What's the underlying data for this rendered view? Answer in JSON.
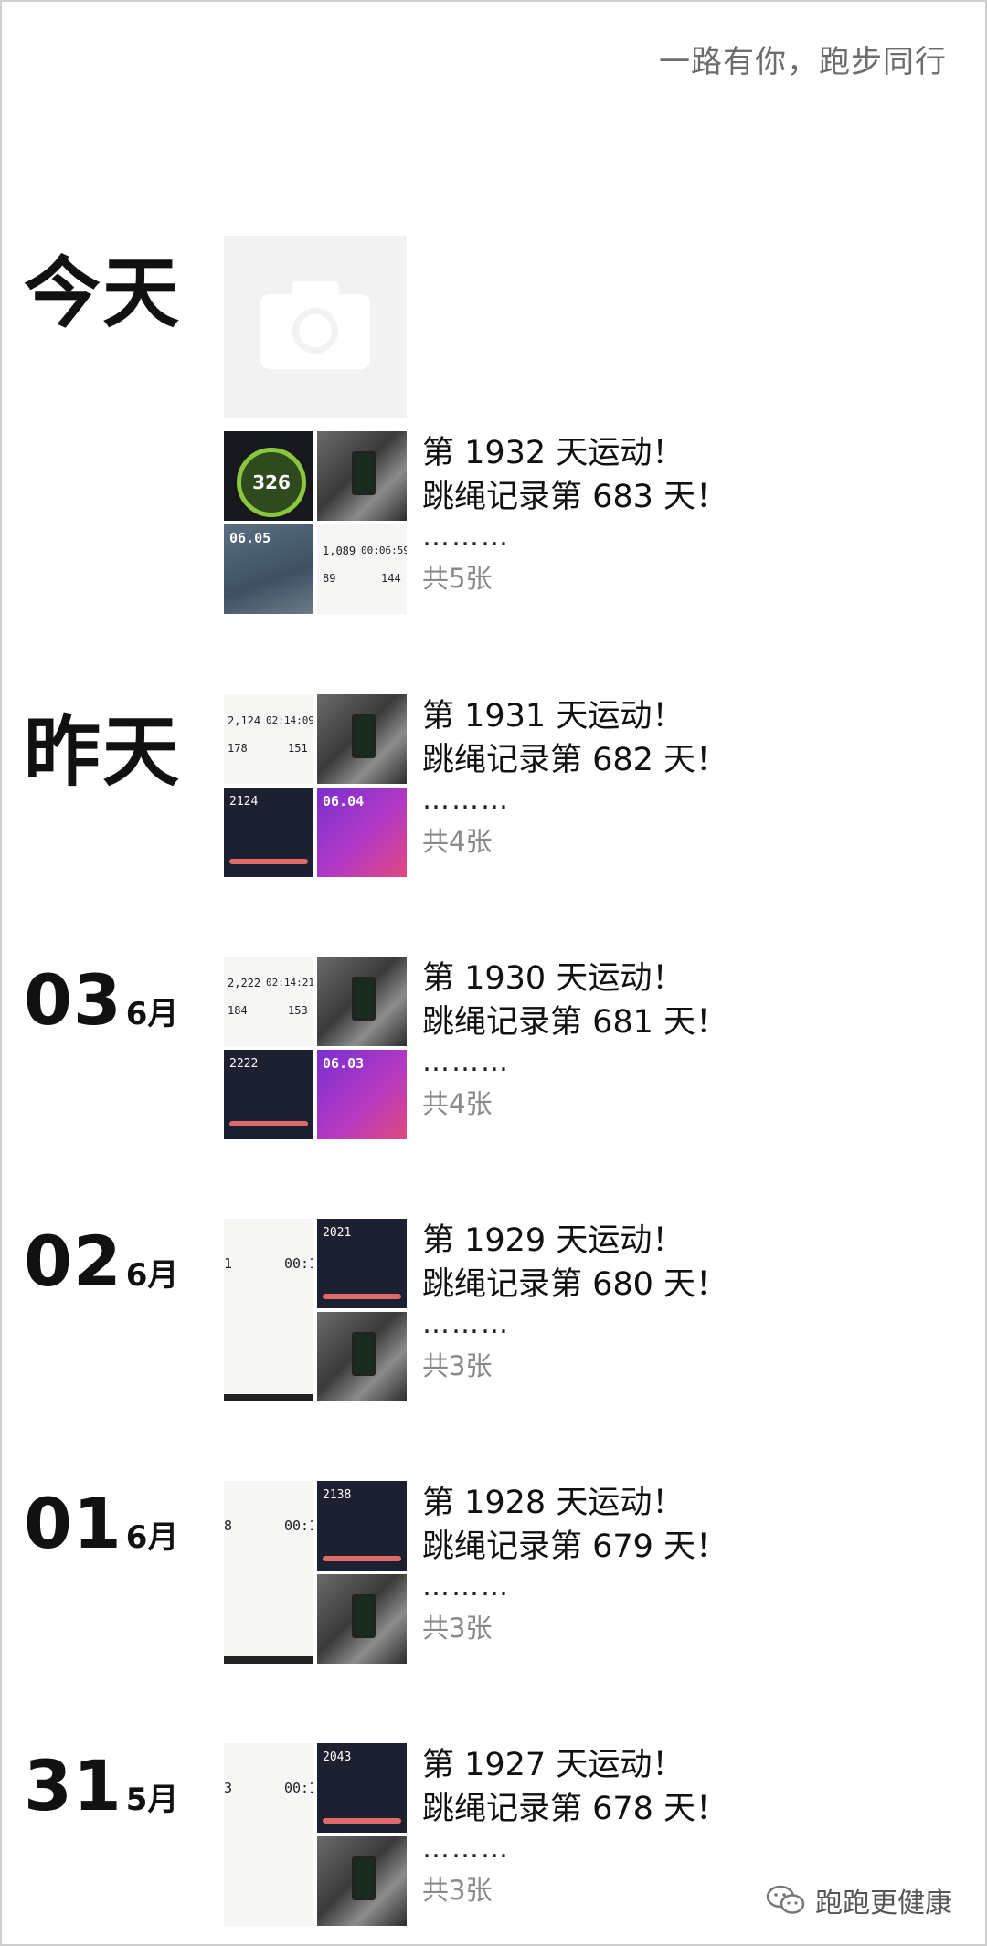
{
  "signature": "一路有你，跑步同行",
  "camera": {
    "icon": "camera-icon"
  },
  "entries": [
    {
      "date_label": "今天",
      "day": "",
      "month": "",
      "line1": "第 1932 天运动！",
      "line2": "跳绳记录第 683 天！",
      "dots": "………",
      "count": "共5张",
      "thumb_text": {
        "badge": "326",
        "date": "06.05",
        "a": "1,089",
        "b": "00:06:59",
        "c": "89",
        "d": "144"
      }
    },
    {
      "date_label": "昨天",
      "day": "",
      "month": "",
      "line1": "第 1931 天运动！",
      "line2": "跳绳记录第 682 天！",
      "dots": "………",
      "count": "共4张",
      "thumb_text": {
        "a": "2,124",
        "b": "02:14:09",
        "c": "178",
        "d": "151",
        "e": "2124",
        "date": "06.04"
      }
    },
    {
      "date_label": "",
      "day": "03",
      "month": "6月",
      "line1": "第 1930 天运动！",
      "line2": "跳绳记录第 681 天！",
      "dots": "………",
      "count": "共4张",
      "thumb_text": {
        "a": "2,222",
        "b": "02:14:21",
        "c": "184",
        "d": "153",
        "e": "2222",
        "date": "06.03"
      }
    },
    {
      "date_label": "",
      "day": "02",
      "month": "6月",
      "line1": "第 1929 天运动！",
      "line2": "跳绳记录第 680 天！",
      "dots": "………",
      "count": "共3张",
      "thumb_text": {
        "a": "1",
        "b": "00:1",
        "e": "2021"
      }
    },
    {
      "date_label": "",
      "day": "01",
      "month": "6月",
      "line1": "第 1928 天运动！",
      "line2": "跳绳记录第 679 天！",
      "dots": "………",
      "count": "共3张",
      "thumb_text": {
        "a": "8",
        "b": "00:1",
        "e": "2138"
      }
    },
    {
      "date_label": "",
      "day": "31",
      "month": "5月",
      "line1": "第 1927 天运动！",
      "line2": "跳绳记录第 678 天！",
      "dots": "………",
      "count": "共3张",
      "thumb_text": {
        "a": "3",
        "b": "00:1",
        "e": "2043"
      }
    }
  ],
  "watermark": {
    "text": "跑跑更健康",
    "icon": "wechat-icon"
  }
}
